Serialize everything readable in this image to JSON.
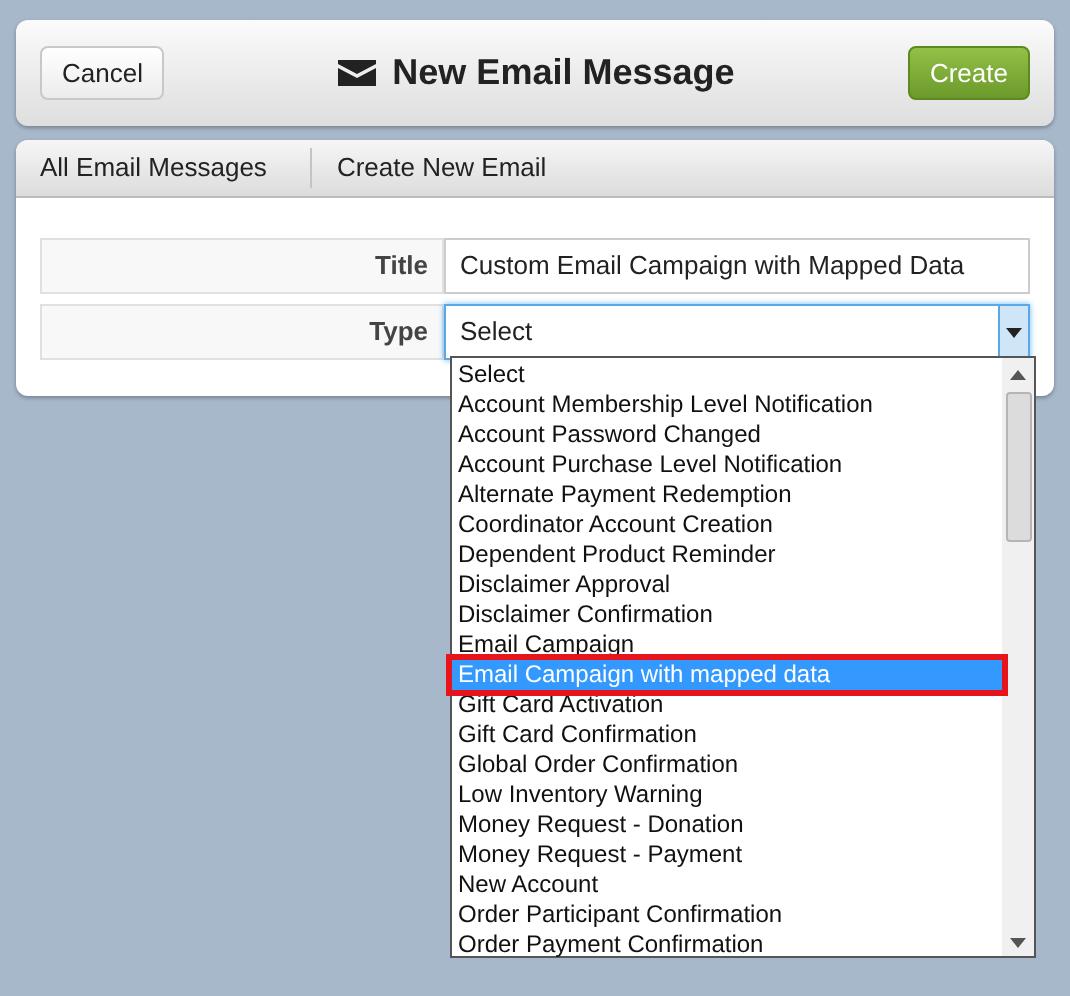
{
  "header": {
    "cancel": "Cancel",
    "title": "New Email Message",
    "create": "Create"
  },
  "breadcrumbs": [
    {
      "label": "All Email Messages",
      "selected": false
    },
    {
      "label": "Create New Email",
      "selected": true
    }
  ],
  "fields": [
    {
      "label": "Title",
      "kind": "text",
      "value": "Custom Email Campaign with Mapped Data"
    },
    {
      "label": "Type",
      "kind": "select",
      "value": "Select",
      "expanded": true
    }
  ],
  "dropdown": {
    "options": [
      {
        "label": "Select",
        "selected": false,
        "highlighted": false
      },
      {
        "label": "Account Membership Level Notification",
        "selected": false,
        "highlighted": false
      },
      {
        "label": "Account Password Changed",
        "selected": false,
        "highlighted": false
      },
      {
        "label": "Account Purchase Level Notification",
        "selected": false,
        "highlighted": false
      },
      {
        "label": "Alternate Payment Redemption",
        "selected": false,
        "highlighted": false
      },
      {
        "label": "Coordinator Account Creation",
        "selected": false,
        "highlighted": false
      },
      {
        "label": "Dependent Product Reminder",
        "selected": false,
        "highlighted": false
      },
      {
        "label": "Disclaimer Approval",
        "selected": false,
        "highlighted": false
      },
      {
        "label": "Disclaimer Confirmation",
        "selected": false,
        "highlighted": false
      },
      {
        "label": "Email Campaign",
        "selected": false,
        "highlighted": false
      },
      {
        "label": "Email Campaign with mapped data",
        "selected": true,
        "highlighted": true
      },
      {
        "label": "Gift Card Activation",
        "selected": false,
        "highlighted": false
      },
      {
        "label": "Gift Card Confirmation",
        "selected": false,
        "highlighted": false
      },
      {
        "label": "Global Order Confirmation",
        "selected": false,
        "highlighted": false
      },
      {
        "label": "Low Inventory Warning",
        "selected": false,
        "highlighted": false
      },
      {
        "label": "Money Request - Donation",
        "selected": false,
        "highlighted": false
      },
      {
        "label": "Money Request - Payment",
        "selected": false,
        "highlighted": false
      },
      {
        "label": "New Account",
        "selected": false,
        "highlighted": false
      },
      {
        "label": "Order Participant Confirmation",
        "selected": false,
        "highlighted": false
      },
      {
        "label": "Order Payment Confirmation",
        "selected": false,
        "highlighted": false
      }
    ]
  }
}
